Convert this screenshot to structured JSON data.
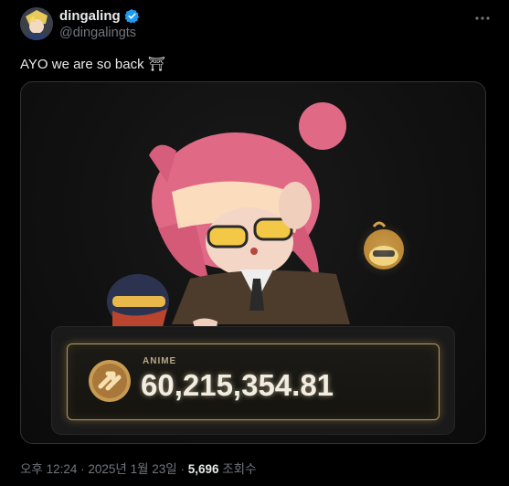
{
  "user": {
    "display_name": "dingaling",
    "handle": "@dingalingts"
  },
  "tweet": {
    "text": "AYO we are so back ⛩",
    "media": {
      "token_label": "ANIME",
      "token_value": "60,215,354.81"
    }
  },
  "meta": {
    "time": "오후 12:24 · 2025년 1월 23일 · ",
    "views_count": "5,696",
    "views_label": " 조회수"
  },
  "colors": {
    "accent": "#1d9bf0",
    "gold": "#c9a35a",
    "text_secondary": "#71767b"
  },
  "icons": [
    "verified-badge-icon",
    "more-options-icon",
    "anime-token-icon"
  ]
}
